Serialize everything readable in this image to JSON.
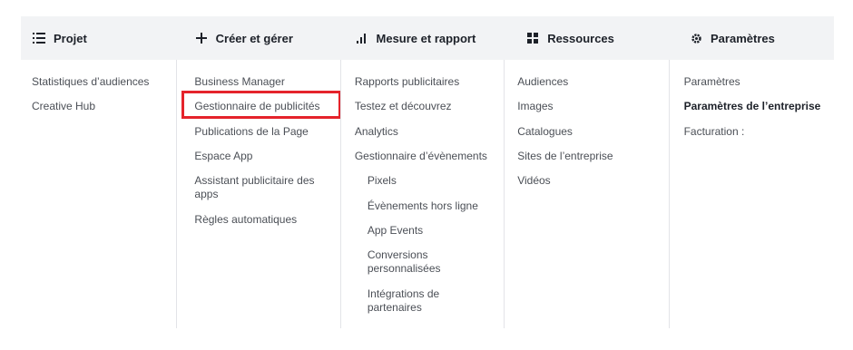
{
  "header": {
    "projet": {
      "label": "Projet",
      "icon": "list-icon"
    },
    "creer": {
      "label": "Créer et gérer",
      "icon": "plus-icon"
    },
    "mesure": {
      "label": "Mesure et rapport",
      "icon": "bar-chart-icon"
    },
    "ressources": {
      "label": "Ressources",
      "icon": "grid-icon"
    },
    "parametres": {
      "label": "Paramètres",
      "icon": "gear-icon"
    }
  },
  "columns": {
    "projet": [
      "Statistiques d’audiences",
      "Creative Hub"
    ],
    "creer": [
      "Business Manager",
      "Gestionnaire de publicités",
      "Publications de la Page",
      "Espace App",
      "Assistant publicitaire des apps",
      "Règles automatiques"
    ],
    "mesure": [
      "Rapports publicitaires",
      "Testez et découvrez",
      "Analytics",
      "Gestionnaire d’évènements",
      "Pixels",
      "Évènements hors ligne",
      "App Events",
      "Conversions personnalisées",
      "Intégrations de partenaires"
    ],
    "ressources": [
      "Audiences",
      "Images",
      "Catalogues",
      "Sites de l’entreprise",
      "Vidéos"
    ],
    "parametres": [
      "Paramètres",
      "Paramètres de l’entreprise",
      "Facturation :"
    ]
  },
  "colors": {
    "highlight": "#e5232b",
    "header_bg": "#f2f3f5",
    "text": "#4b4f56"
  }
}
